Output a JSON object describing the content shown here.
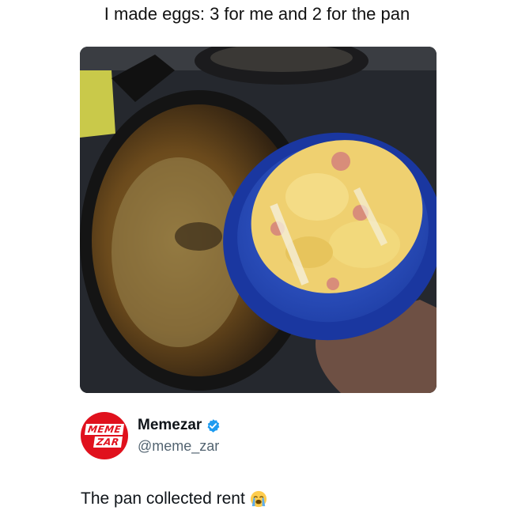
{
  "headline": "I made eggs: 3 for me and 2 for the pan",
  "photo": {
    "description_icon": "photo-pan-and-bowl-of-eggs"
  },
  "author": {
    "avatar_line1": "MEME",
    "avatar_line2": "ZAR",
    "display_name": "Memezar",
    "handle": "@meme_zar",
    "verified_icon": "verified-badge-icon",
    "brand_color": "#e0111d",
    "verified_color": "#1d9bf0"
  },
  "tweet": {
    "text": "The pan collected rent",
    "emoji_icon": "loudly-crying-face-icon"
  }
}
